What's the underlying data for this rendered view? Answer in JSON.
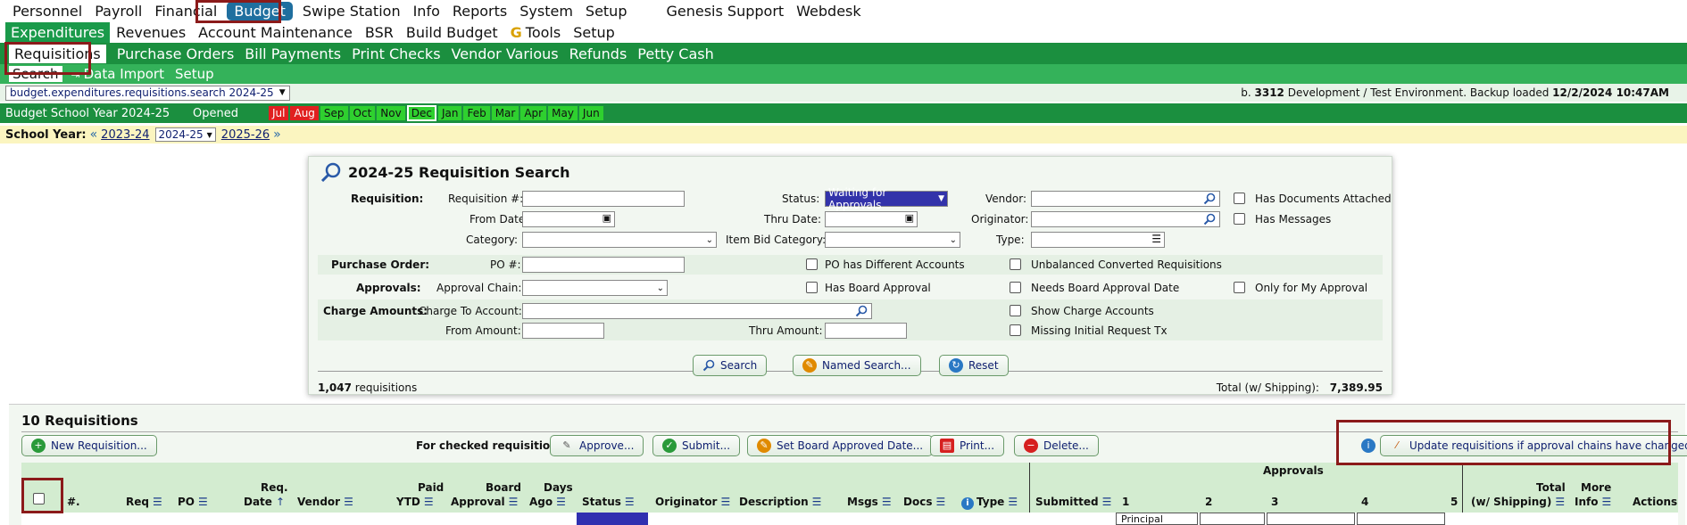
{
  "top_menu": [
    "Personnel",
    "Payroll",
    "Financial",
    "Budget",
    "Swipe Station",
    "Info",
    "Reports",
    "System",
    "Setup",
    "Genesis Support",
    "Webdesk"
  ],
  "second_menu": [
    "Expenditures",
    "Revenues",
    "Account Maintenance",
    "BSR",
    "Build Budget",
    "Tools",
    "Setup"
  ],
  "tab_bar": [
    "Requisitions",
    "Purchase Orders",
    "Bill Payments",
    "Print Checks",
    "Vendor Various",
    "Refunds",
    "Petty Cash"
  ],
  "sub_bar": [
    "Search",
    "Data Import",
    "Setup"
  ],
  "path_select": "budget.expenditures.requisitions.search 2024-25",
  "env": {
    "prefix": "b.",
    "build": "3312",
    "text": "Development / Test Environment. Backup loaded",
    "date": "12/2/2024 10:47AM"
  },
  "budget_year": {
    "label": "Budget School Year 2024-25",
    "status": "Opened",
    "months": [
      "Jul",
      "Aug",
      "Sep",
      "Oct",
      "Nov",
      "Dec",
      "Jan",
      "Feb",
      "Mar",
      "Apr",
      "May",
      "Jun"
    ]
  },
  "school_year": {
    "label": "School Year:",
    "prev": "2023-24",
    "current": "2024-25",
    "next": "2025-26"
  },
  "search_panel": {
    "title": "2024-25 Requisition Search",
    "labels": {
      "requisition": "Requisition:",
      "req_num": "Requisition #:",
      "from_date": "From Date:",
      "category": "Category:",
      "status": "Status:",
      "thru_date": "Thru Date:",
      "item_bid_category": "Item Bid Category:",
      "vendor": "Vendor:",
      "originator": "Originator:",
      "type": "Type:",
      "has_docs": "Has Documents Attached",
      "has_messages": "Has Messages",
      "purchase_order": "Purchase Order:",
      "po_num": "PO #:",
      "po_diff_accounts": "PO has Different Accounts",
      "unbalanced": "Unbalanced Converted Requisitions",
      "approvals": "Approvals:",
      "approval_chain": "Approval Chain:",
      "has_board_approval": "Has Board Approval",
      "needs_board_date": "Needs Board Approval Date",
      "only_my_approval": "Only for My Approval",
      "charge_amounts": "Charge Amounts:",
      "charge_to_account": "Charge To Account:",
      "from_amount": "From Amount:",
      "thru_amount": "Thru Amount:",
      "show_charge_accounts": "Show Charge Accounts",
      "missing_initial": "Missing Initial Request Tx"
    },
    "status_value": "Waiting for Approvals",
    "buttons": {
      "search": "Search",
      "named_search": "Named Search...",
      "reset": "Reset"
    },
    "count": "1,047",
    "count_label": "requisitions",
    "total_label": "Total (w/ Shipping):",
    "total_value": "7,389.95"
  },
  "results": {
    "title": "10 Requisitions",
    "new_button": "New Requisition...",
    "checked_label": "For checked requisitions:",
    "actions": [
      "Approve...",
      "Submit...",
      "Set Board Approved Date...",
      "Print...",
      "Delete..."
    ],
    "update_button": "Update requisitions if approval chains have changed...",
    "approvals_header": "Approvals",
    "columns": {
      "num": "#.",
      "req": "Req",
      "po": "PO",
      "req_date_top": "Req.",
      "req_date": "Date",
      "vendor": "Vendor",
      "paid_top": "Paid",
      "paid": "YTD",
      "board_top": "Board",
      "board": "Approval",
      "days_top": "Days",
      "days": "Ago",
      "status": "Status",
      "originator": "Originator",
      "description": "Description",
      "msgs": "Msgs",
      "docs": "Docs",
      "type": "Type",
      "submitted": "Submitted",
      "a1": "1",
      "a2": "2",
      "a3": "3",
      "a4": "4",
      "a5": "5",
      "total_top": "Total",
      "total": "(w/ Shipping)",
      "more_top": "More",
      "more": "Info",
      "actions": "Actions"
    },
    "first_row_approver": "Principal"
  },
  "icons": [
    "search-icon",
    "calendar-icon",
    "hamburger-icon",
    "info-icon",
    "plus-icon",
    "check-icon",
    "pencil-icon",
    "pdf-icon",
    "delete-icon",
    "refresh-icon",
    "tools-icon",
    "checkbox-icon"
  ]
}
